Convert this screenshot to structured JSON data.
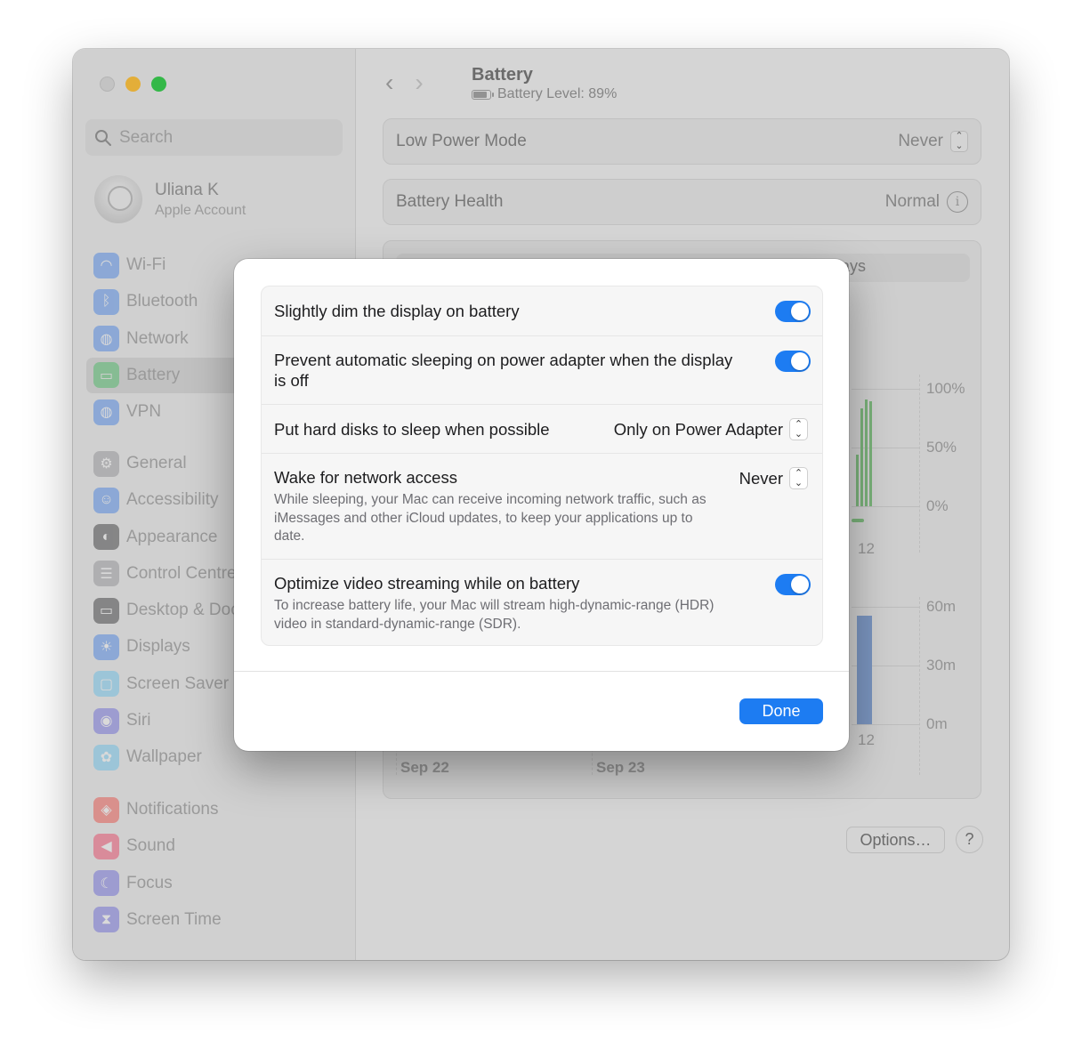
{
  "sidebar": {
    "search_placeholder": "Search",
    "account": {
      "name": "Uliana K",
      "subtitle": "Apple Account"
    },
    "groups": [
      [
        {
          "label": "Wi-Fi",
          "icon": "wifi-icon",
          "color": "#2f7cf6"
        },
        {
          "label": "Bluetooth",
          "icon": "bluetooth-icon",
          "color": "#2f7cf6"
        },
        {
          "label": "Network",
          "icon": "globe-icon",
          "color": "#2f7cf6"
        },
        {
          "label": "Battery",
          "icon": "battery-icon",
          "color": "#34c759",
          "active": true
        },
        {
          "label": "VPN",
          "icon": "vpn-globe-icon",
          "color": "#2f7cf6"
        }
      ],
      [
        {
          "label": "General",
          "icon": "gear-icon",
          "color": "#8e8e93"
        },
        {
          "label": "Accessibility",
          "icon": "accessibility-icon",
          "color": "#2f7cf6"
        },
        {
          "label": "Appearance",
          "icon": "appearance-icon",
          "color": "#1c1c1e"
        },
        {
          "label": "Control Centre",
          "icon": "control-centre-icon",
          "color": "#8e8e93"
        },
        {
          "label": "Desktop & Dock",
          "icon": "desktop-dock-icon",
          "color": "#1c1c1e"
        },
        {
          "label": "Displays",
          "icon": "sun-icon",
          "color": "#2f7cf6"
        },
        {
          "label": "Screen Saver",
          "icon": "screen-saver-icon",
          "color": "#5ac8fa"
        },
        {
          "label": "Siri",
          "icon": "siri-icon",
          "color": "#5e5ce6"
        },
        {
          "label": "Wallpaper",
          "icon": "wallpaper-icon",
          "color": "#5ac8fa"
        }
      ],
      [
        {
          "label": "Notifications",
          "icon": "bell-icon",
          "color": "#ff3b30"
        },
        {
          "label": "Sound",
          "icon": "speaker-icon",
          "color": "#ff2d55"
        },
        {
          "label": "Focus",
          "icon": "moon-icon",
          "color": "#5e5ce6"
        },
        {
          "label": "Screen Time",
          "icon": "hourglass-icon",
          "color": "#5e5ce6"
        }
      ]
    ]
  },
  "header": {
    "back": "‹",
    "forward": "›",
    "title": "Battery",
    "subtitle": "Battery Level: 89%"
  },
  "settings": {
    "low_power_label": "Low Power Mode",
    "low_power_value": "Never",
    "health_label": "Battery Health",
    "health_value": "Normal",
    "segment_visible": "ays"
  },
  "chart_data": [
    {
      "type": "bar",
      "title": "",
      "y_ticks": [
        "100%",
        "50%",
        "0%"
      ],
      "x_ticks": [
        "12"
      ],
      "ylim": [
        0,
        100
      ],
      "color": "#7cc07c"
    },
    {
      "type": "bar",
      "title": "",
      "y_ticks": [
        "60m",
        "30m",
        "0m"
      ],
      "x_ticks": [
        "12"
      ],
      "ylim": [
        0,
        60
      ],
      "color": "#7c9bcf"
    }
  ],
  "dates": [
    "Sep 22",
    "Sep 23"
  ],
  "buttons": {
    "options": "Options…",
    "help": "?"
  },
  "dialog": {
    "dim": {
      "label": "Slightly dim the display on battery",
      "on": true
    },
    "prevent_sleep": {
      "label": "Prevent automatic sleeping on power adapter when the display is off",
      "on": true
    },
    "hard_disks": {
      "label": "Put hard disks to sleep when possible",
      "value": "Only on Power Adapter"
    },
    "wake": {
      "label": "Wake for network access",
      "value": "Never",
      "desc": "While sleeping, your Mac can receive incoming network traffic, such as iMessages and other iCloud updates, to keep your applications up to date."
    },
    "video": {
      "label": "Optimize video streaming while on battery",
      "on": true,
      "desc": "To increase battery life, your Mac will stream high-dynamic-range (HDR) video in standard-dynamic-range (SDR)."
    },
    "done": "Done"
  }
}
